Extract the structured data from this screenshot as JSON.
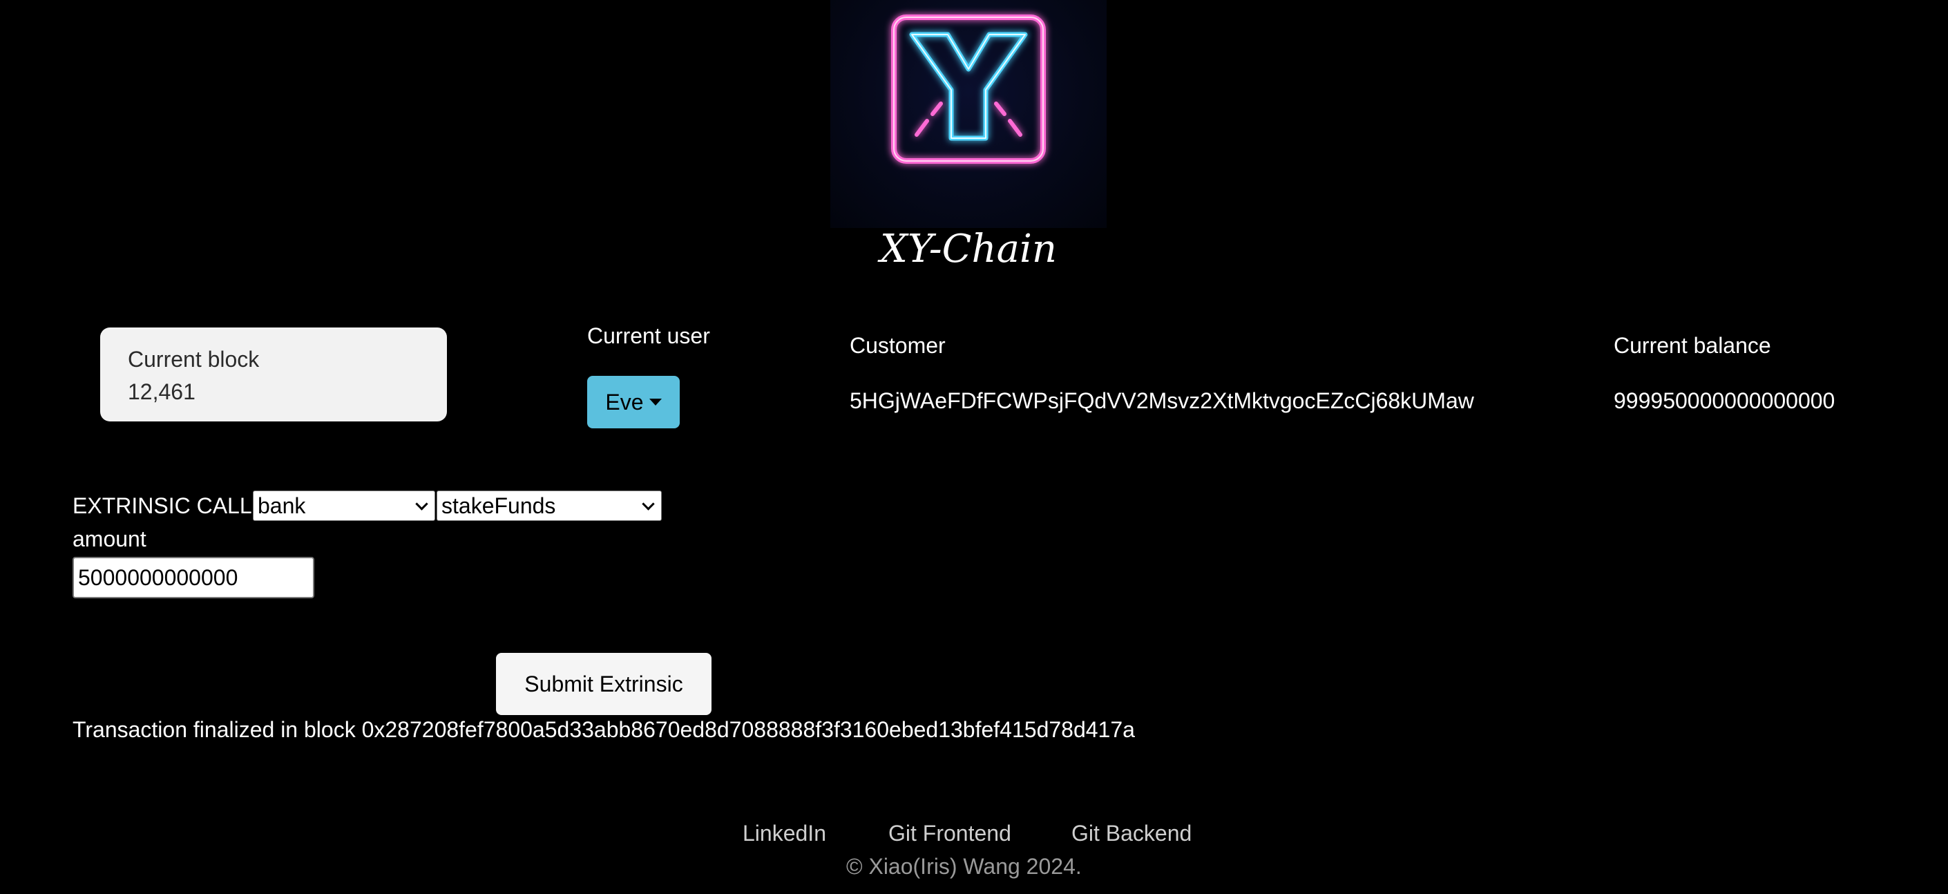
{
  "brand": {
    "title": "XY-Chain",
    "logo": "neon-xy-logo-icon"
  },
  "block": {
    "label": "Current block",
    "value": "12,461"
  },
  "user": {
    "label": "Current user",
    "selected": "Eve",
    "icon": "caret-down-icon"
  },
  "account_table": {
    "headers": {
      "customer": "Customer",
      "balance": "Current balance"
    },
    "row": {
      "customer": "5HGjWAeFDfFCWPsjFQdVV2Msvz2XtMktvgocEZcCj68kUMaw",
      "balance": "999950000000000000"
    }
  },
  "extrinsic": {
    "label": "EXTRINSIC CALL",
    "pallet": "bank",
    "call": "stakeFunds",
    "amount_label": "amount",
    "amount_value": "5000000000000",
    "submit_label": "Submit Extrinsic"
  },
  "status": "Transaction finalized in block 0x287208fef7800a5d33abb8670ed8d7088888f3f3160ebed13bfef415d78d417a",
  "footer": {
    "links": [
      "LinkedIn",
      "Git Frontend",
      "Git Backend"
    ],
    "copyright": "© Xiao(Iris) Wang 2024."
  },
  "colors": {
    "background": "#000000",
    "user_button": "#5bc0de",
    "logo_neon_blue": "#4fd6ff",
    "logo_neon_pink": "#ff6ad5"
  }
}
